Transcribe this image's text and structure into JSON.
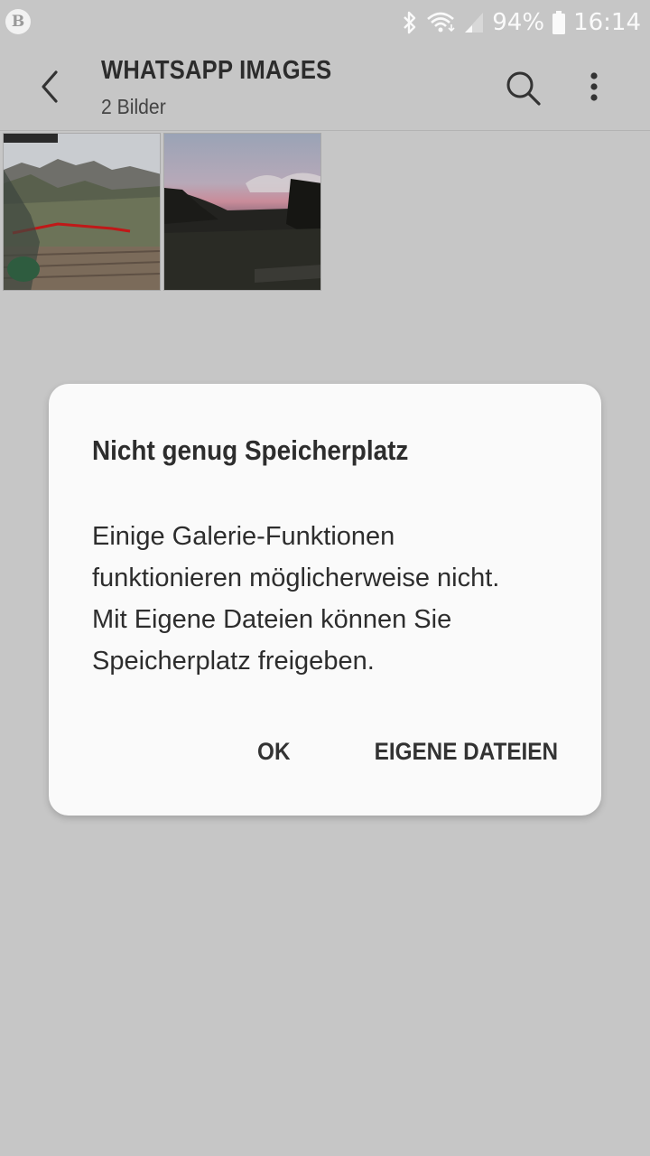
{
  "status_bar": {
    "notification_badge": "B",
    "battery_percent": "94%",
    "time": "16:14",
    "icons": [
      "bluetooth-icon",
      "wifi-icon",
      "signal-icon",
      "battery-icon"
    ]
  },
  "appbar": {
    "title": "WHATSAPP IMAGES",
    "subtitle": "2 Bilder",
    "icons": [
      "back-arrow-icon",
      "search-icon",
      "more-vert-icon"
    ]
  },
  "gallery": {
    "items": [
      {
        "label": "mountain-deck-photo"
      },
      {
        "label": "sunset-landscape-photo"
      }
    ]
  },
  "dialog": {
    "title": "Nicht genug Speicherplatz",
    "message": "Einige Galerie-Funktionen\nfunktionieren möglicherweise nicht.\nMit Eigene Dateien können Sie\nSpeicherplatz freigeben.",
    "ok_label": "OK",
    "files_label": "EIGENE DATEIEN"
  },
  "colors": {
    "background": "#c6c6c6",
    "dialog_bg": "#fafafa",
    "text": "#2d2d2d"
  }
}
